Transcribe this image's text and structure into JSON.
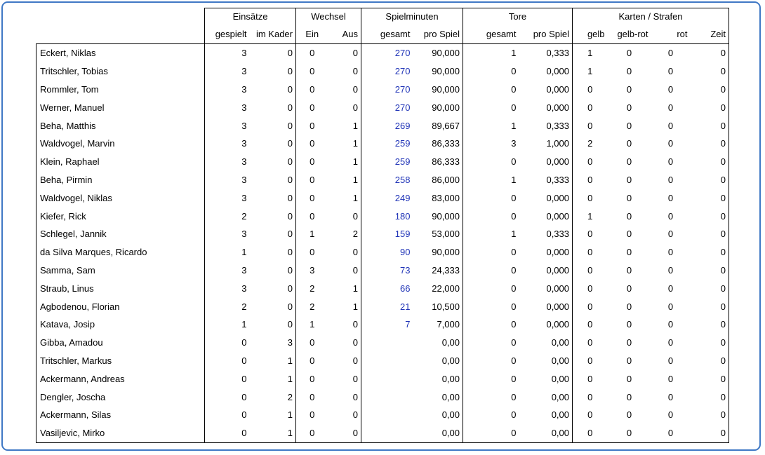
{
  "groups": [
    "Einsätze",
    "Wechsel",
    "Spielminuten",
    "Tore",
    "Karten / Strafen"
  ],
  "subheaders": {
    "gespielt": "gespielt",
    "im_kader": "im Kader",
    "ein": "Ein",
    "aus": "Aus",
    "sp_gesamt": "gesamt",
    "sp_pro_spiel": "pro Spiel",
    "tore_gesamt": "gesamt",
    "tore_pro_spiel": "pro Spiel",
    "gelb": "gelb",
    "gelb_rot": "gelb-rot",
    "rot": "rot",
    "zeit": "Zeit"
  },
  "colors": {
    "frame_border": "#3f78c5",
    "minutes_text": "#1f33b7"
  },
  "rows": [
    [
      "Eckert, Niklas",
      "3",
      "0",
      "0",
      "0",
      "270",
      "90,000",
      "1",
      "0,333",
      "1",
      "0",
      "0",
      "0"
    ],
    [
      "Tritschler, Tobias",
      "3",
      "0",
      "0",
      "0",
      "270",
      "90,000",
      "0",
      "0,000",
      "1",
      "0",
      "0",
      "0"
    ],
    [
      "Rommler, Tom",
      "3",
      "0",
      "0",
      "0",
      "270",
      "90,000",
      "0",
      "0,000",
      "0",
      "0",
      "0",
      "0"
    ],
    [
      "Werner, Manuel",
      "3",
      "0",
      "0",
      "0",
      "270",
      "90,000",
      "0",
      "0,000",
      "0",
      "0",
      "0",
      "0"
    ],
    [
      "Beha, Matthis",
      "3",
      "0",
      "0",
      "1",
      "269",
      "89,667",
      "1",
      "0,333",
      "0",
      "0",
      "0",
      "0"
    ],
    [
      "Waldvogel, Marvin",
      "3",
      "0",
      "0",
      "1",
      "259",
      "86,333",
      "3",
      "1,000",
      "2",
      "0",
      "0",
      "0"
    ],
    [
      "Klein, Raphael",
      "3",
      "0",
      "0",
      "1",
      "259",
      "86,333",
      "0",
      "0,000",
      "0",
      "0",
      "0",
      "0"
    ],
    [
      "Beha, Pirmin",
      "3",
      "0",
      "0",
      "1",
      "258",
      "86,000",
      "1",
      "0,333",
      "0",
      "0",
      "0",
      "0"
    ],
    [
      "Waldvogel, Niklas",
      "3",
      "0",
      "0",
      "1",
      "249",
      "83,000",
      "0",
      "0,000",
      "0",
      "0",
      "0",
      "0"
    ],
    [
      "Kiefer, Rick",
      "2",
      "0",
      "0",
      "0",
      "180",
      "90,000",
      "0",
      "0,000",
      "1",
      "0",
      "0",
      "0"
    ],
    [
      "Schlegel, Jannik",
      "3",
      "0",
      "1",
      "2",
      "159",
      "53,000",
      "1",
      "0,333",
      "0",
      "0",
      "0",
      "0"
    ],
    [
      "da Silva Marques, Ricardo",
      "1",
      "0",
      "0",
      "0",
      "90",
      "90,000",
      "0",
      "0,000",
      "0",
      "0",
      "0",
      "0"
    ],
    [
      "Samma, Sam",
      "3",
      "0",
      "3",
      "0",
      "73",
      "24,333",
      "0",
      "0,000",
      "0",
      "0",
      "0",
      "0"
    ],
    [
      "Straub, Linus",
      "3",
      "0",
      "2",
      "1",
      "66",
      "22,000",
      "0",
      "0,000",
      "0",
      "0",
      "0",
      "0"
    ],
    [
      "Agbodenou, Florian",
      "2",
      "0",
      "2",
      "1",
      "21",
      "10,500",
      "0",
      "0,000",
      "0",
      "0",
      "0",
      "0"
    ],
    [
      "Katava, Josip",
      "1",
      "0",
      "1",
      "0",
      "7",
      "7,000",
      "0",
      "0,000",
      "0",
      "0",
      "0",
      "0"
    ],
    [
      "Gibba, Amadou",
      "0",
      "3",
      "0",
      "0",
      "",
      "0,00",
      "0",
      "0,00",
      "0",
      "0",
      "0",
      "0"
    ],
    [
      "Tritschler, Markus",
      "0",
      "1",
      "0",
      "0",
      "",
      "0,00",
      "0",
      "0,00",
      "0",
      "0",
      "0",
      "0"
    ],
    [
      "Ackermann, Andreas",
      "0",
      "1",
      "0",
      "0",
      "",
      "0,00",
      "0",
      "0,00",
      "0",
      "0",
      "0",
      "0"
    ],
    [
      "Dengler, Joscha",
      "0",
      "2",
      "0",
      "0",
      "",
      "0,00",
      "0",
      "0,00",
      "0",
      "0",
      "0",
      "0"
    ],
    [
      "Ackermann, Silas",
      "0",
      "1",
      "0",
      "0",
      "",
      "0,00",
      "0",
      "0,00",
      "0",
      "0",
      "0",
      "0"
    ],
    [
      "Vasiljevic, Mirko",
      "0",
      "1",
      "0",
      "0",
      "",
      "0,00",
      "0",
      "0,00",
      "0",
      "0",
      "0",
      "0"
    ]
  ]
}
